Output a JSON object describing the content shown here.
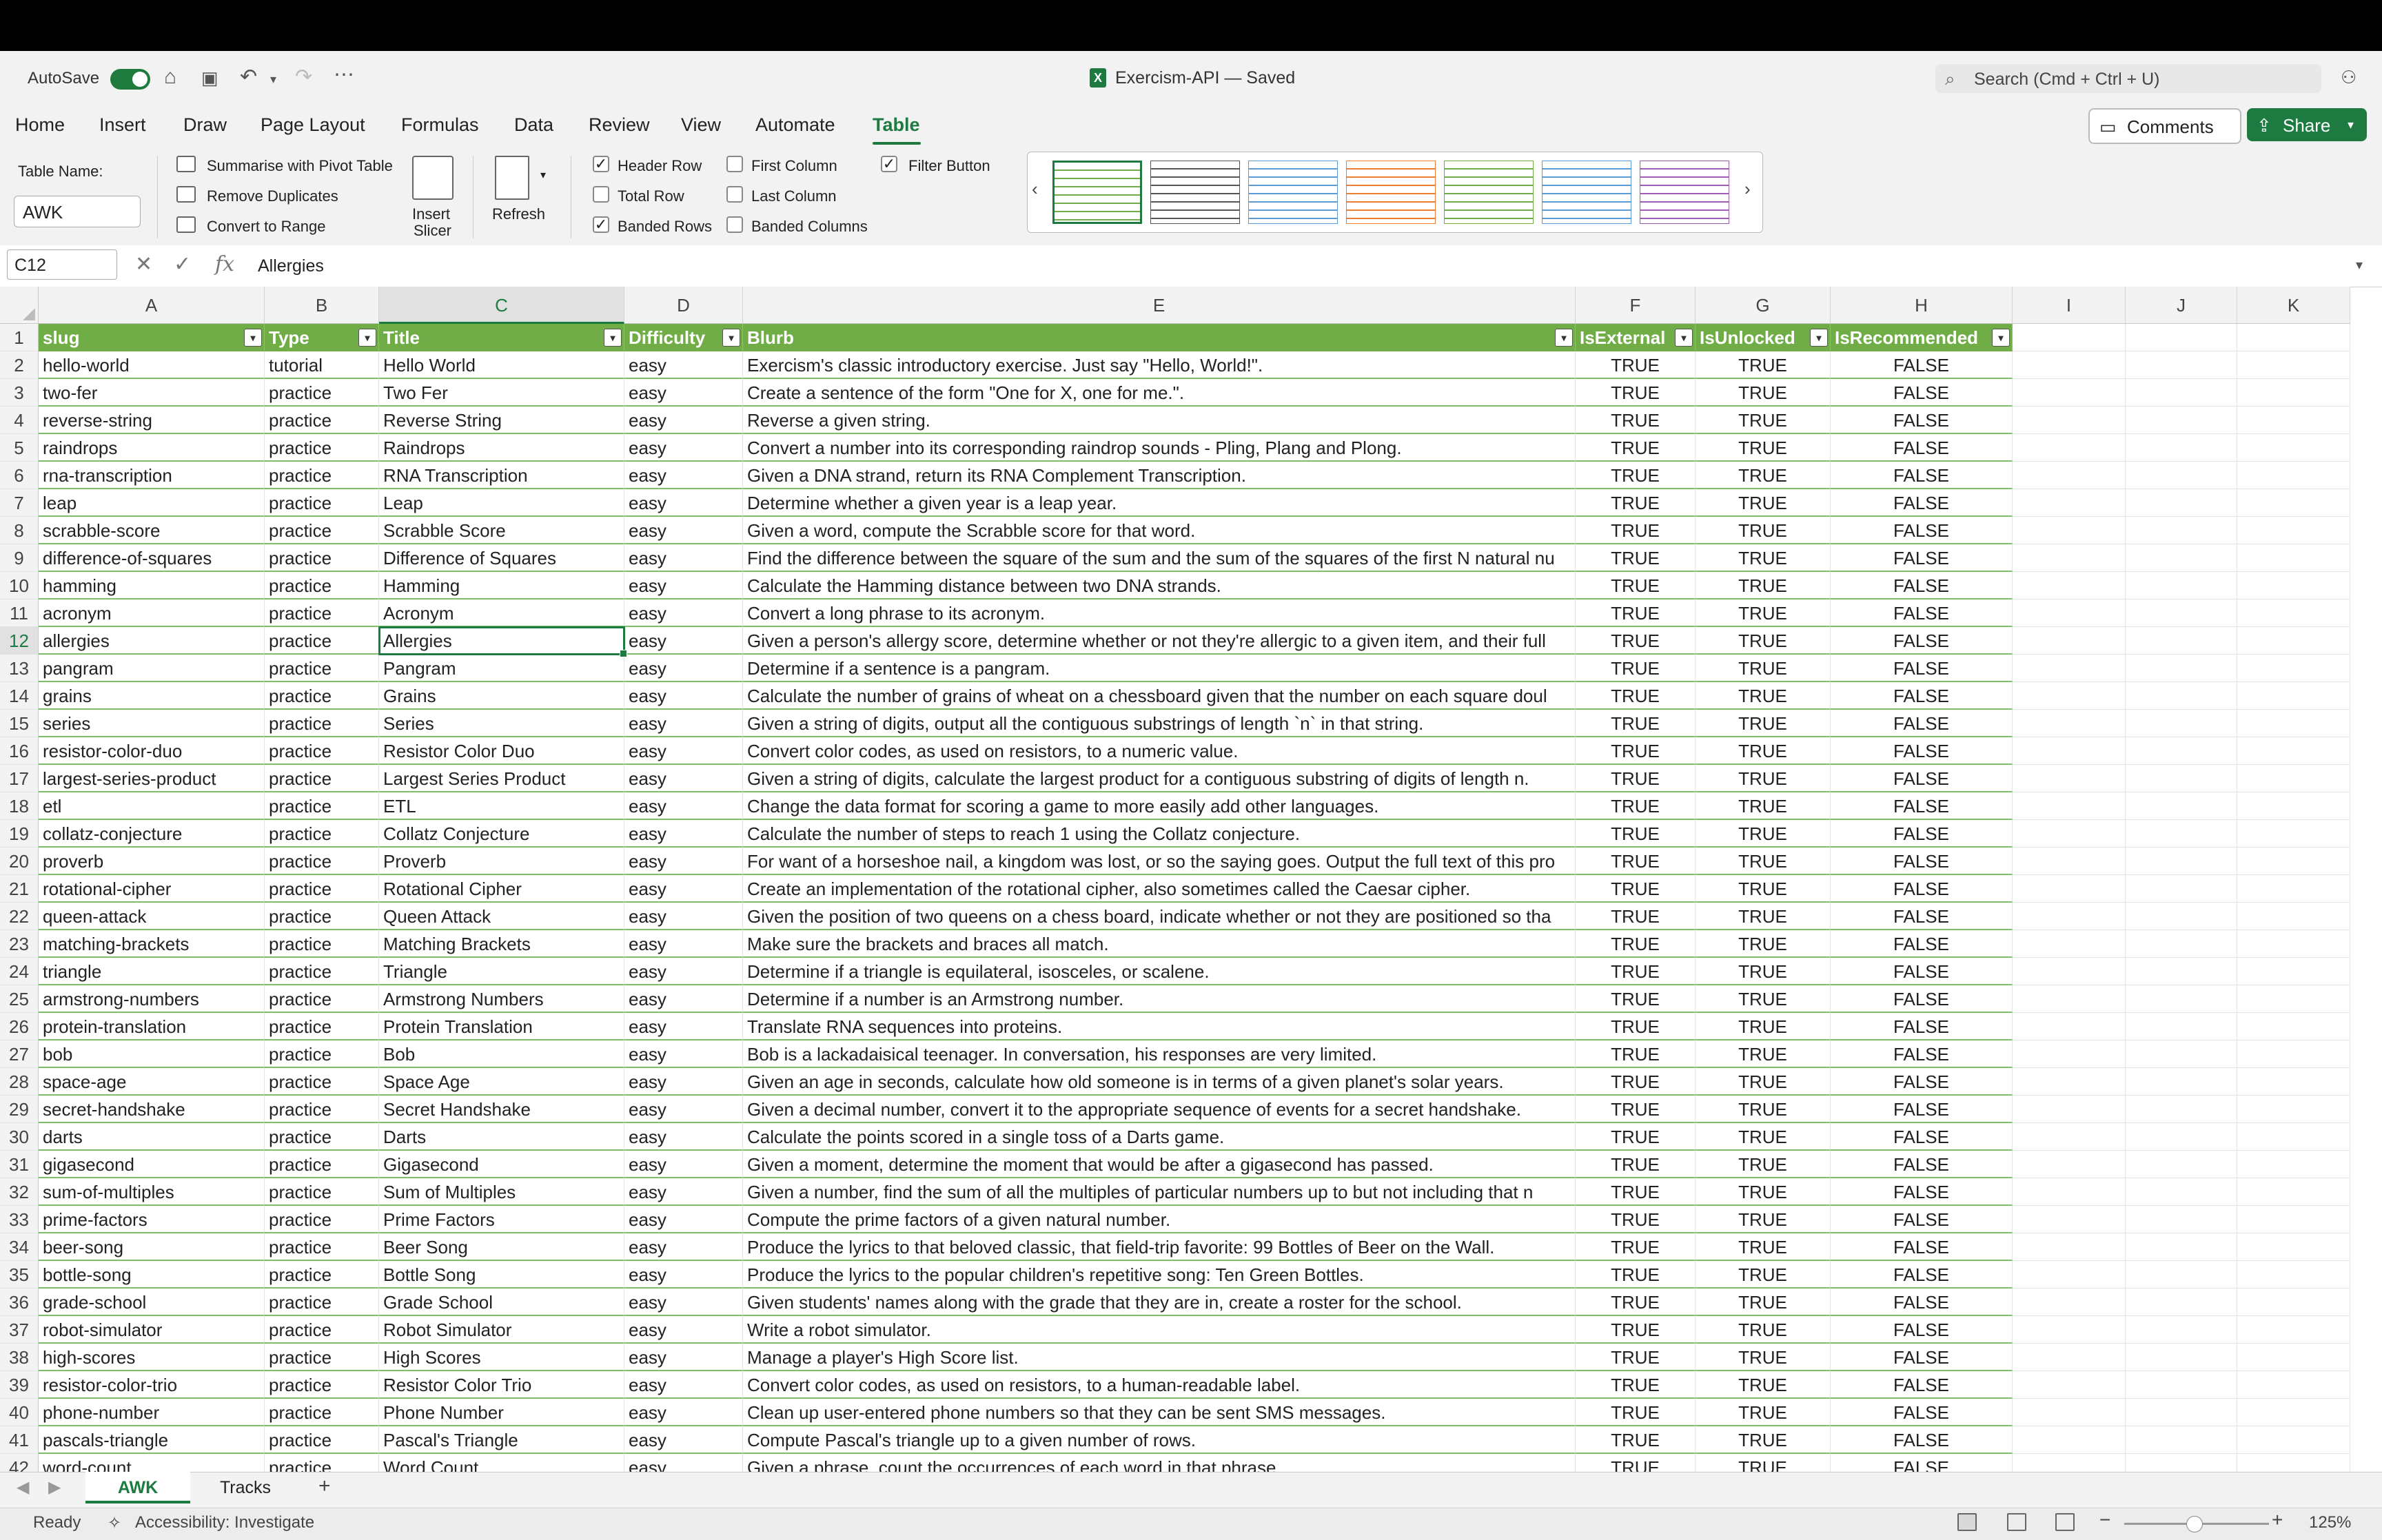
{
  "titlebar": {
    "autosave_label": "AutoSave",
    "doc_title": "Exercism-API — Saved",
    "search_placeholder": "Search (Cmd + Ctrl + U)"
  },
  "menu": [
    "Home",
    "Insert",
    "Draw",
    "Page Layout",
    "Formulas",
    "Data",
    "Review",
    "View",
    "Automate",
    "Table"
  ],
  "menu_active": "Table",
  "buttons": {
    "comments": "Comments",
    "share": "Share"
  },
  "ribbon": {
    "table_name_label": "Table Name:",
    "table_name_value": "AWK",
    "tools": [
      "Summarise with Pivot Table",
      "Remove Duplicates",
      "Convert to Range"
    ],
    "insert_slicer": [
      "Insert",
      "Slicer"
    ],
    "refresh": "Refresh",
    "options": [
      {
        "label": "Header Row",
        "checked": true
      },
      {
        "label": "Total Row",
        "checked": false
      },
      {
        "label": "Banded Rows",
        "checked": true
      },
      {
        "label": "First Column",
        "checked": false
      },
      {
        "label": "Last Column",
        "checked": false
      },
      {
        "label": "Banded Columns",
        "checked": false
      },
      {
        "label": "Filter Button",
        "checked": true
      }
    ],
    "style_colors": [
      "#70ad47",
      "#555555",
      "#5b9bd5",
      "#ed7d31",
      "#70ad47",
      "#5b9bd5",
      "#a05bb5"
    ]
  },
  "formula_bar": {
    "name_box": "C12",
    "formula": "Allergies"
  },
  "columns": [
    "A",
    "B",
    "C",
    "D",
    "E",
    "F",
    "G",
    "H",
    "I",
    "J",
    "K"
  ],
  "selected_column": "C",
  "selected_row": "12",
  "table": {
    "headers": [
      "slug",
      "Type",
      "Title",
      "Difficulty",
      "Blurb",
      "IsExternal",
      "IsUnlocked",
      "IsRecommended"
    ],
    "rows": [
      [
        "hello-world",
        "tutorial",
        "Hello World",
        "easy",
        "Exercism's classic introductory exercise. Just say \"Hello, World!\".",
        "TRUE",
        "TRUE",
        "FALSE"
      ],
      [
        "two-fer",
        "practice",
        "Two Fer",
        "easy",
        "Create a sentence of the form \"One for X, one for me.\".",
        "TRUE",
        "TRUE",
        "FALSE"
      ],
      [
        "reverse-string",
        "practice",
        "Reverse String",
        "easy",
        "Reverse a given string.",
        "TRUE",
        "TRUE",
        "FALSE"
      ],
      [
        "raindrops",
        "practice",
        "Raindrops",
        "easy",
        "Convert a number into its corresponding raindrop sounds - Pling, Plang and Plong.",
        "TRUE",
        "TRUE",
        "FALSE"
      ],
      [
        "rna-transcription",
        "practice",
        "RNA Transcription",
        "easy",
        "Given a DNA strand, return its RNA Complement Transcription.",
        "TRUE",
        "TRUE",
        "FALSE"
      ],
      [
        "leap",
        "practice",
        "Leap",
        "easy",
        "Determine whether a given year is a leap year.",
        "TRUE",
        "TRUE",
        "FALSE"
      ],
      [
        "scrabble-score",
        "practice",
        "Scrabble Score",
        "easy",
        "Given a word, compute the Scrabble score for that word.",
        "TRUE",
        "TRUE",
        "FALSE"
      ],
      [
        "difference-of-squares",
        "practice",
        "Difference of Squares",
        "easy",
        "Find the difference between the square of the sum and the sum of the squares of the first N natural nu",
        "TRUE",
        "TRUE",
        "FALSE"
      ],
      [
        "hamming",
        "practice",
        "Hamming",
        "easy",
        "Calculate the Hamming distance between two DNA strands.",
        "TRUE",
        "TRUE",
        "FALSE"
      ],
      [
        "acronym",
        "practice",
        "Acronym",
        "easy",
        "Convert a long phrase to its acronym.",
        "TRUE",
        "TRUE",
        "FALSE"
      ],
      [
        "allergies",
        "practice",
        "Allergies",
        "easy",
        "Given a person's allergy score, determine whether or not they're allergic to a given item, and their full",
        "TRUE",
        "TRUE",
        "FALSE"
      ],
      [
        "pangram",
        "practice",
        "Pangram",
        "easy",
        "Determine if a sentence is a pangram.",
        "TRUE",
        "TRUE",
        "FALSE"
      ],
      [
        "grains",
        "practice",
        "Grains",
        "easy",
        "Calculate the number of grains of wheat on a chessboard given that the number on each square doul",
        "TRUE",
        "TRUE",
        "FALSE"
      ],
      [
        "series",
        "practice",
        "Series",
        "easy",
        "Given a string of digits, output all the contiguous substrings of length `n` in that string.",
        "TRUE",
        "TRUE",
        "FALSE"
      ],
      [
        "resistor-color-duo",
        "practice",
        "Resistor Color Duo",
        "easy",
        "Convert color codes, as used on resistors, to a numeric value.",
        "TRUE",
        "TRUE",
        "FALSE"
      ],
      [
        "largest-series-product",
        "practice",
        "Largest Series Product",
        "easy",
        "Given a string of digits, calculate the largest product for a contiguous substring of digits of length n.",
        "TRUE",
        "TRUE",
        "FALSE"
      ],
      [
        "etl",
        "practice",
        "ETL",
        "easy",
        "Change the data format for scoring a game to more easily add other languages.",
        "TRUE",
        "TRUE",
        "FALSE"
      ],
      [
        "collatz-conjecture",
        "practice",
        "Collatz Conjecture",
        "easy",
        "Calculate the number of steps to reach 1 using the Collatz conjecture.",
        "TRUE",
        "TRUE",
        "FALSE"
      ],
      [
        "proverb",
        "practice",
        "Proverb",
        "easy",
        "For want of a horseshoe nail, a kingdom was lost, or so the saying goes. Output the full text of this pro",
        "TRUE",
        "TRUE",
        "FALSE"
      ],
      [
        "rotational-cipher",
        "practice",
        "Rotational Cipher",
        "easy",
        "Create an implementation of the rotational cipher, also sometimes called the Caesar cipher.",
        "TRUE",
        "TRUE",
        "FALSE"
      ],
      [
        "queen-attack",
        "practice",
        "Queen Attack",
        "easy",
        "Given the position of two queens on a chess board, indicate whether or not they are positioned so tha",
        "TRUE",
        "TRUE",
        "FALSE"
      ],
      [
        "matching-brackets",
        "practice",
        "Matching Brackets",
        "easy",
        "Make sure the brackets and braces all match.",
        "TRUE",
        "TRUE",
        "FALSE"
      ],
      [
        "triangle",
        "practice",
        "Triangle",
        "easy",
        "Determine if a triangle is equilateral, isosceles, or scalene.",
        "TRUE",
        "TRUE",
        "FALSE"
      ],
      [
        "armstrong-numbers",
        "practice",
        "Armstrong Numbers",
        "easy",
        "Determine if a number is an Armstrong number.",
        "TRUE",
        "TRUE",
        "FALSE"
      ],
      [
        "protein-translation",
        "practice",
        "Protein Translation",
        "easy",
        "Translate RNA sequences into proteins.",
        "TRUE",
        "TRUE",
        "FALSE"
      ],
      [
        "bob",
        "practice",
        "Bob",
        "easy",
        "Bob is a lackadaisical teenager. In conversation, his responses are very limited.",
        "TRUE",
        "TRUE",
        "FALSE"
      ],
      [
        "space-age",
        "practice",
        "Space Age",
        "easy",
        "Given an age in seconds, calculate how old someone is in terms of a given planet's solar years.",
        "TRUE",
        "TRUE",
        "FALSE"
      ],
      [
        "secret-handshake",
        "practice",
        "Secret Handshake",
        "easy",
        "Given a decimal number, convert it to the appropriate sequence of events for a secret handshake.",
        "TRUE",
        "TRUE",
        "FALSE"
      ],
      [
        "darts",
        "practice",
        "Darts",
        "easy",
        "Calculate the points scored in a single toss of a Darts game.",
        "TRUE",
        "TRUE",
        "FALSE"
      ],
      [
        "gigasecond",
        "practice",
        "Gigasecond",
        "easy",
        "Given a moment, determine the moment that would be after a gigasecond has passed.",
        "TRUE",
        "TRUE",
        "FALSE"
      ],
      [
        "sum-of-multiples",
        "practice",
        "Sum of Multiples",
        "easy",
        "Given a number, find the sum of all the multiples of particular numbers up to but not including that n",
        "TRUE",
        "TRUE",
        "FALSE"
      ],
      [
        "prime-factors",
        "practice",
        "Prime Factors",
        "easy",
        "Compute the prime factors of a given natural number.",
        "TRUE",
        "TRUE",
        "FALSE"
      ],
      [
        "beer-song",
        "practice",
        "Beer Song",
        "easy",
        "Produce the lyrics to that beloved classic, that field-trip favorite: 99 Bottles of Beer on the Wall.",
        "TRUE",
        "TRUE",
        "FALSE"
      ],
      [
        "bottle-song",
        "practice",
        "Bottle Song",
        "easy",
        "Produce the lyrics to the popular children's repetitive song: Ten Green Bottles.",
        "TRUE",
        "TRUE",
        "FALSE"
      ],
      [
        "grade-school",
        "practice",
        "Grade School",
        "easy",
        "Given students' names along with the grade that they are in, create a roster for the school.",
        "TRUE",
        "TRUE",
        "FALSE"
      ],
      [
        "robot-simulator",
        "practice",
        "Robot Simulator",
        "easy",
        "Write a robot simulator.",
        "TRUE",
        "TRUE",
        "FALSE"
      ],
      [
        "high-scores",
        "practice",
        "High Scores",
        "easy",
        "Manage a player's High Score list.",
        "TRUE",
        "TRUE",
        "FALSE"
      ],
      [
        "resistor-color-trio",
        "practice",
        "Resistor Color Trio",
        "easy",
        "Convert color codes, as used on resistors, to a human-readable label.",
        "TRUE",
        "TRUE",
        "FALSE"
      ],
      [
        "phone-number",
        "practice",
        "Phone Number",
        "easy",
        "Clean up user-entered phone numbers so that they can be sent SMS messages.",
        "TRUE",
        "TRUE",
        "FALSE"
      ],
      [
        "pascals-triangle",
        "practice",
        "Pascal's Triangle",
        "easy",
        "Compute Pascal's triangle up to a given number of rows.",
        "TRUE",
        "TRUE",
        "FALSE"
      ],
      [
        "word-count",
        "practice",
        "Word Count",
        "easy",
        "Given a phrase, count the occurrences of each word in that phrase.",
        "TRUE",
        "TRUE",
        "FALSE"
      ]
    ]
  },
  "sheets": [
    "AWK",
    "Tracks"
  ],
  "active_sheet": "AWK",
  "status": {
    "ready": "Ready",
    "accessibility": "Accessibility: Investigate",
    "zoom": "125%"
  }
}
